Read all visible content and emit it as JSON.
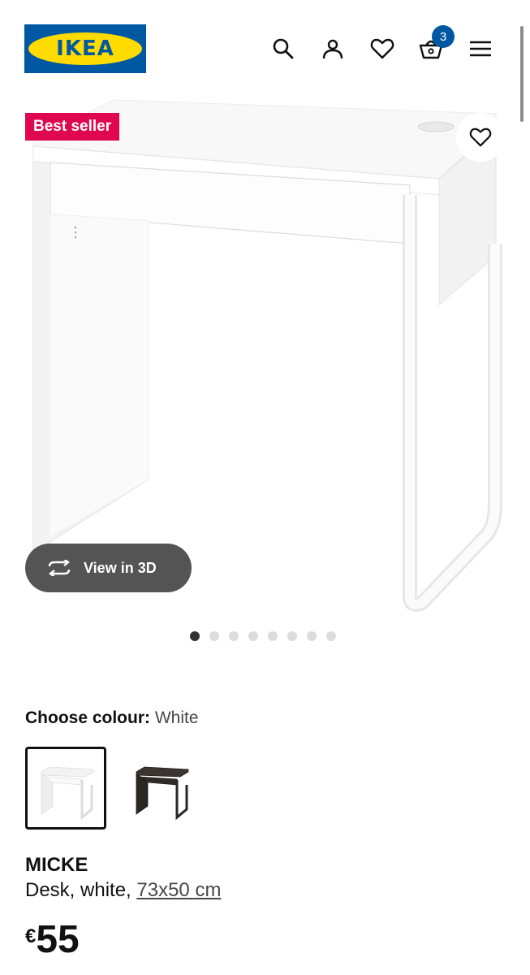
{
  "header": {
    "logo_text": "IKEA",
    "icons": [
      "search-icon",
      "account-icon",
      "heart-icon",
      "basket-icon",
      "menu-icon"
    ],
    "cart_count": "3"
  },
  "product_image": {
    "badge": "Best seller",
    "view_3d_label": "View in 3D",
    "carousel": {
      "total": 8,
      "active_index": 1
    }
  },
  "colour": {
    "label": "Choose colour:",
    "value": "White",
    "options": [
      "white",
      "black-brown"
    ]
  },
  "product": {
    "name": "MICKE",
    "description_prefix": "Desk, white, ",
    "size": "73x50 cm",
    "currency": "€",
    "price": "55"
  },
  "colors": {
    "ikea_blue": "#0058a3",
    "ikea_yellow": "#ffdb00",
    "badge_red": "#e00751",
    "button_gray": "#545454"
  }
}
